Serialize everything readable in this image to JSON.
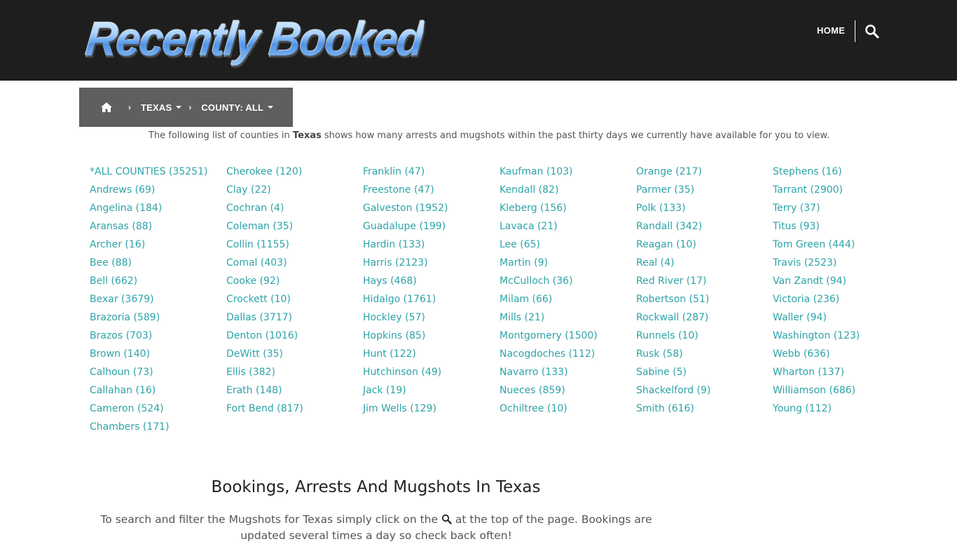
{
  "header": {
    "logo_text": "Recently Booked",
    "nav_home": "HOME",
    "search_icon": "magnifier-icon"
  },
  "breadcrumb": {
    "home_icon": "home-icon",
    "state": "TEXAS",
    "county": "COUNTY: ALL"
  },
  "intro": {
    "before": "The following list of counties in ",
    "state": "Texas",
    "after": " shows how many arrests and mugshots within the past thirty days we currently have available for you to view."
  },
  "counties": [
    [
      "*ALL COUNTIES (35251)",
      "Andrews (69)",
      "Angelina (184)",
      "Aransas (88)",
      "Archer (16)",
      "Bee (88)",
      "Bell (662)",
      "Bexar (3679)",
      "Brazoria (589)",
      "Brazos (703)",
      "Brown (140)",
      "Calhoun (73)",
      "Callahan (16)",
      "Cameron (524)",
      "Chambers (171)"
    ],
    [
      "Cherokee (120)",
      "Clay (22)",
      "Cochran (4)",
      "Coleman (35)",
      "Collin (1155)",
      "Comal (403)",
      "Cooke (92)",
      "Crockett (10)",
      "Dallas (3717)",
      "Denton (1016)",
      "DeWitt (35)",
      "Ellis (382)",
      "Erath (148)",
      "Fort Bend (817)"
    ],
    [
      "Franklin (47)",
      "Freestone (47)",
      "Galveston (1952)",
      "Guadalupe (199)",
      "Hardin (133)",
      "Harris (2123)",
      "Hays (468)",
      "Hidalgo (1761)",
      "Hockley (57)",
      "Hopkins (85)",
      "Hunt (122)",
      "Hutchinson (49)",
      "Jack (19)",
      "Jim Wells (129)"
    ],
    [
      "Kaufman (103)",
      "Kendall (82)",
      "Kleberg (156)",
      "Lavaca (21)",
      "Lee (65)",
      "Martin (9)",
      "McCulloch (36)",
      "Milam (66)",
      "Mills (21)",
      "Montgomery (1500)",
      "Nacogdoches (112)",
      "Navarro (133)",
      "Nueces (859)",
      "Ochiltree (10)"
    ],
    [
      "Orange (217)",
      "Parmer (35)",
      "Polk (133)",
      "Randall (342)",
      "Reagan (10)",
      "Real (4)",
      "Red River (17)",
      "Robertson (51)",
      "Rockwall (287)",
      "Runnels (10)",
      "Rusk (58)",
      "Sabine (5)",
      "Shackelford (9)",
      "Smith (616)"
    ],
    [
      "Stephens (16)",
      "Tarrant (2900)",
      "Terry (37)",
      "Titus (93)",
      "Tom Green (444)",
      "Travis (2523)",
      "Van Zandt (94)",
      "Victoria (236)",
      "Waller (94)",
      "Washington (123)",
      "Webb (636)",
      "Wharton (137)",
      "Williamson (686)",
      "Young (112)"
    ]
  ],
  "section": {
    "title": "Bookings, Arrests And Mugshots In Texas",
    "text_before": "To search and filter the Mugshots for Texas simply click on the ",
    "text_after": " at the top of the page. Bookings are updated several times a day so check back often!"
  },
  "colors": {
    "header_bg": "#1e1e1e",
    "breadcrumb_bg": "#5f5f5f",
    "link": "#2ea3a8"
  }
}
